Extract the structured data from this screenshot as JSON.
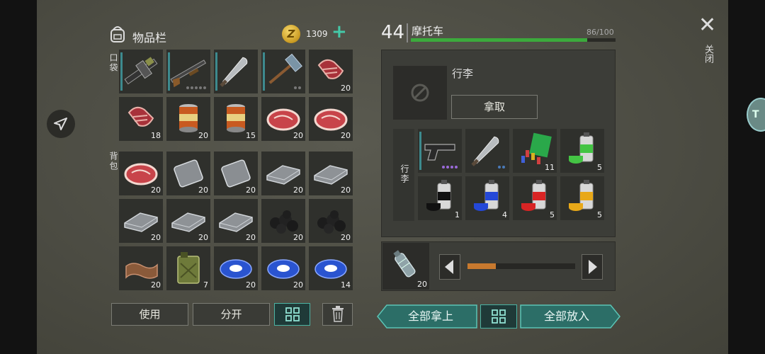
{
  "inventory": {
    "title": "物品栏",
    "coins": "1309",
    "pocket_label": "口袋",
    "backpack_label": "背包",
    "pocket": [
      {
        "icon": "flamethrower-icon",
        "count": "",
        "marked": true
      },
      {
        "icon": "shotgun-icon",
        "count": "",
        "marked": true,
        "dots": 5
      },
      {
        "icon": "machete-icon",
        "count": "",
        "marked": true
      },
      {
        "icon": "sledgehammer-icon",
        "count": "",
        "marked": true,
        "dots": 2
      },
      {
        "icon": "raw-meat-icon",
        "count": "20"
      },
      {
        "icon": "raw-meat-icon",
        "count": "18"
      },
      {
        "icon": "canned-food-icon",
        "count": "20"
      },
      {
        "icon": "canned-food-icon",
        "count": "15"
      },
      {
        "icon": "steak-icon",
        "count": "20"
      },
      {
        "icon": "steak-icon",
        "count": "20"
      }
    ],
    "backpack": [
      {
        "icon": "steak-icon",
        "count": "20"
      },
      {
        "icon": "metal-plate-icon",
        "count": "20"
      },
      {
        "icon": "metal-plate-icon",
        "count": "20"
      },
      {
        "icon": "iron-bar-icon",
        "count": "20"
      },
      {
        "icon": "iron-bar-icon",
        "count": "20"
      },
      {
        "icon": "iron-bar-icon",
        "count": "20"
      },
      {
        "icon": "iron-bar-icon",
        "count": "20"
      },
      {
        "icon": "iron-bar-icon",
        "count": "20"
      },
      {
        "icon": "coal-icon",
        "count": "20"
      },
      {
        "icon": "coal-icon",
        "count": "20"
      },
      {
        "icon": "leather-icon",
        "count": "20"
      },
      {
        "icon": "jerrycan-icon",
        "count": "7"
      },
      {
        "icon": "tape-icon",
        "count": "20"
      },
      {
        "icon": "tape-icon",
        "count": "20"
      },
      {
        "icon": "tape-icon",
        "count": "14"
      }
    ],
    "use_label": "使用",
    "split_label": "分开"
  },
  "vehicle": {
    "level": "44",
    "name": "摩托车",
    "capacity": "86/100",
    "capacity_fraction": 0.86,
    "luggage_title": "行李",
    "take_label": "拿取",
    "storage_label": "行李",
    "storage": [
      {
        "icon": "pistol-icon",
        "count": "",
        "marked": true,
        "dots": 4,
        "dot_color": "#9a6ad8"
      },
      {
        "icon": "machete-icon",
        "count": "",
        "dots": 2,
        "dot_color": "#4a7ab8"
      },
      {
        "icon": "ammo-pile-icon",
        "count": "11"
      },
      {
        "icon": "spray-paint-green-icon",
        "count": "5",
        "paint": "#44c444"
      },
      {
        "icon": "spray-paint-black-icon",
        "count": "1",
        "paint": "#111111"
      },
      {
        "icon": "spray-paint-blue-icon",
        "count": "4",
        "paint": "#2448d8"
      },
      {
        "icon": "spray-paint-red-icon",
        "count": "5",
        "paint": "#d82424"
      },
      {
        "icon": "spray-paint-yellow-icon",
        "count": "5",
        "paint": "#e8a818"
      }
    ],
    "fuel_slot_count": "20",
    "fuel_fraction": 0.26,
    "take_all_label": "全部拿上",
    "put_all_label": "全部放入"
  },
  "close_label": "关闭",
  "colors": {
    "accent": "#2c6e67",
    "capacity_bar": "#3caa3c",
    "slider": "#c8792e"
  }
}
